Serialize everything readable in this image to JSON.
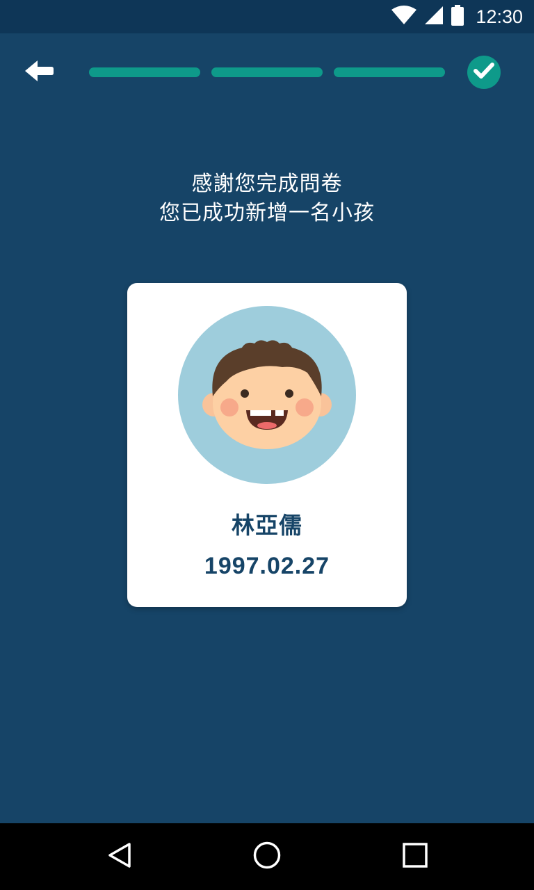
{
  "status_bar": {
    "time": "12:30",
    "icons": [
      "wifi-icon",
      "cell-signal-icon",
      "battery-icon"
    ]
  },
  "header": {
    "back_icon": "arrow-left-icon",
    "progress_steps_completed": 3,
    "progress_steps_total": 3,
    "done_icon": "check-circle-icon"
  },
  "message": {
    "line1": "感謝您完成問卷",
    "line2": "您已成功新增一名小孩"
  },
  "child_card": {
    "avatar_icon": "child-avatar-icon",
    "name": "林亞儒",
    "birthdate": "1997.02.27"
  },
  "nav_bar": {
    "icons": [
      "back-triangle-icon",
      "home-circle-icon",
      "recents-square-icon"
    ]
  },
  "colors": {
    "background": "#164467",
    "status_bar": "#0e3657",
    "accent": "#0e9a8a",
    "card": "#ffffff",
    "text_dark": "#164467",
    "avatar_bg": "#9ecddc"
  }
}
